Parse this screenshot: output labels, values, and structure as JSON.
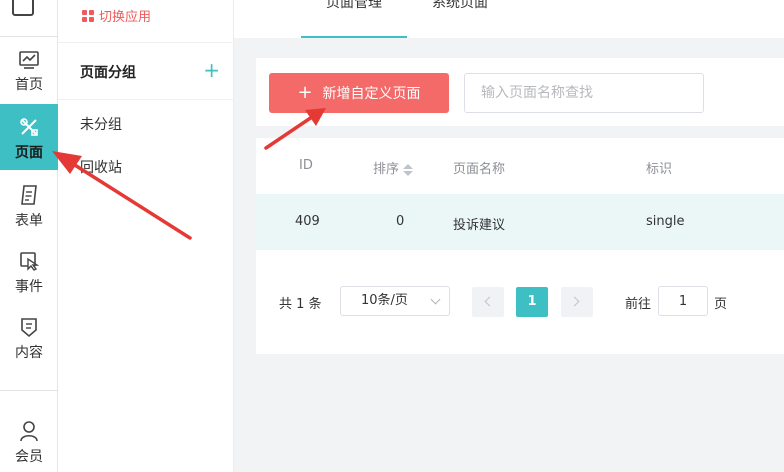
{
  "rail": {
    "items": [
      {
        "label": "首页",
        "icon": "chart-monitor-icon"
      },
      {
        "label": "页面",
        "icon": "design-tools-icon",
        "active": true
      },
      {
        "label": "表单",
        "icon": "form-document-icon"
      },
      {
        "label": "事件",
        "icon": "event-hand-icon"
      },
      {
        "label": "内容",
        "icon": "content-shield-icon"
      }
    ],
    "member": {
      "label": "会员",
      "icon": "user-icon"
    },
    "active_color": "#3dbfc4"
  },
  "groups": {
    "switch_app": "切换应用",
    "title": "页面分组",
    "add_symbol": "+",
    "items": [
      "未分组",
      "回收站"
    ]
  },
  "tabs": [
    {
      "label": "页面管理",
      "active": true
    },
    {
      "label": "系统页面",
      "active": false
    }
  ],
  "toolbar": {
    "add_button": "新增自定义页面",
    "add_button_color": "#f36a69",
    "search_placeholder": "输入页面名称查找"
  },
  "table": {
    "columns": [
      "ID",
      "排序",
      "页面名称",
      "标识"
    ],
    "rows": [
      {
        "id": "409",
        "sort": "0",
        "name": "投诉建议",
        "identifier": "single"
      }
    ]
  },
  "pagination": {
    "total": "共 1 条",
    "page_size": "10条/页",
    "current_page": "1",
    "goto_label": "前往",
    "goto_value": "1",
    "goto_unit": "页"
  },
  "annotation_color": "#e53935"
}
